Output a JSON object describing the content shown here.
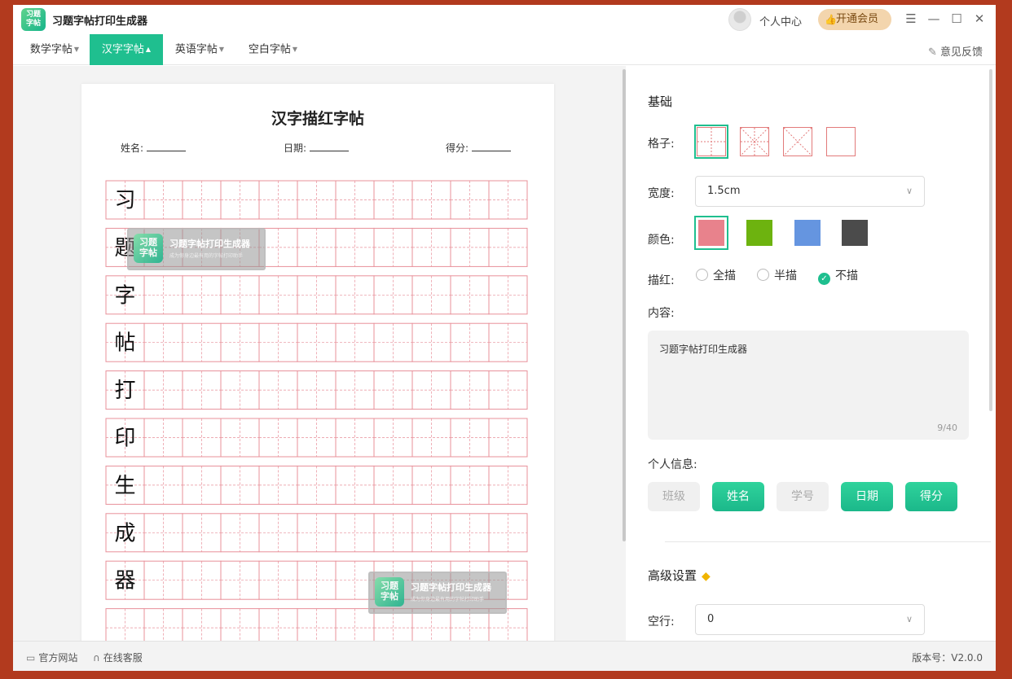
{
  "titlebar": {
    "logo_text": "习题字帖",
    "app_title": "习题字帖打印生成器",
    "user_center": "个人中心",
    "vip_button": "开通会员",
    "icons": [
      "menu-icon",
      "minimize-icon",
      "maximize-icon",
      "close-icon"
    ]
  },
  "menu": {
    "tabs": [
      {
        "label": "数学字帖"
      },
      {
        "label": "汉字字帖"
      },
      {
        "label": "英语字帖"
      },
      {
        "label": "空白字帖"
      }
    ],
    "active_tab": "汉字字帖",
    "feedback": "意见反馈"
  },
  "paper": {
    "title": "汉字描红字帖",
    "name_label": "姓名:",
    "date_label": "日期:",
    "score_label": "得分:",
    "characters": [
      "习",
      "题",
      "字",
      "帖",
      "打",
      "印",
      "生",
      "成",
      "器"
    ],
    "grid_color": "#e8909a",
    "watermark": {
      "logo_text": "习题字帖",
      "title": "习题字帖打印生成器",
      "subtitle": "成为你身边最有用的字帖打印助手"
    }
  },
  "settings": {
    "basic_title": "基础",
    "grid_label": "格子:",
    "grid_styles": [
      "田字格",
      "米字格",
      "叉字格",
      "方格"
    ],
    "grid_selected": "田字格",
    "width_label": "宽度:",
    "width_value": "1.5cm",
    "color_label": "颜色:",
    "colors": [
      "#e8828c",
      "#6db30f",
      "#6595e0",
      "#4b4b4b"
    ],
    "color_selected": "#e8828c",
    "trace_label": "描红:",
    "trace_options": [
      "全描",
      "半描",
      "不描"
    ],
    "trace_selected": "不描",
    "content_label": "内容:",
    "content_value": "习题字帖打印生成器",
    "content_count": "9/40",
    "info_label": "个人信息:",
    "info_buttons": [
      {
        "label": "班级",
        "on": false
      },
      {
        "label": "姓名",
        "on": true
      },
      {
        "label": "学号",
        "on": false
      },
      {
        "label": "日期",
        "on": true
      },
      {
        "label": "得分",
        "on": true
      }
    ],
    "advanced_title": "高级设置",
    "empty_rows_label": "空行:",
    "empty_rows_value": "0"
  },
  "status": {
    "website": "官方网站",
    "support": "在线客服",
    "version": "版本号：V2.0.0"
  }
}
